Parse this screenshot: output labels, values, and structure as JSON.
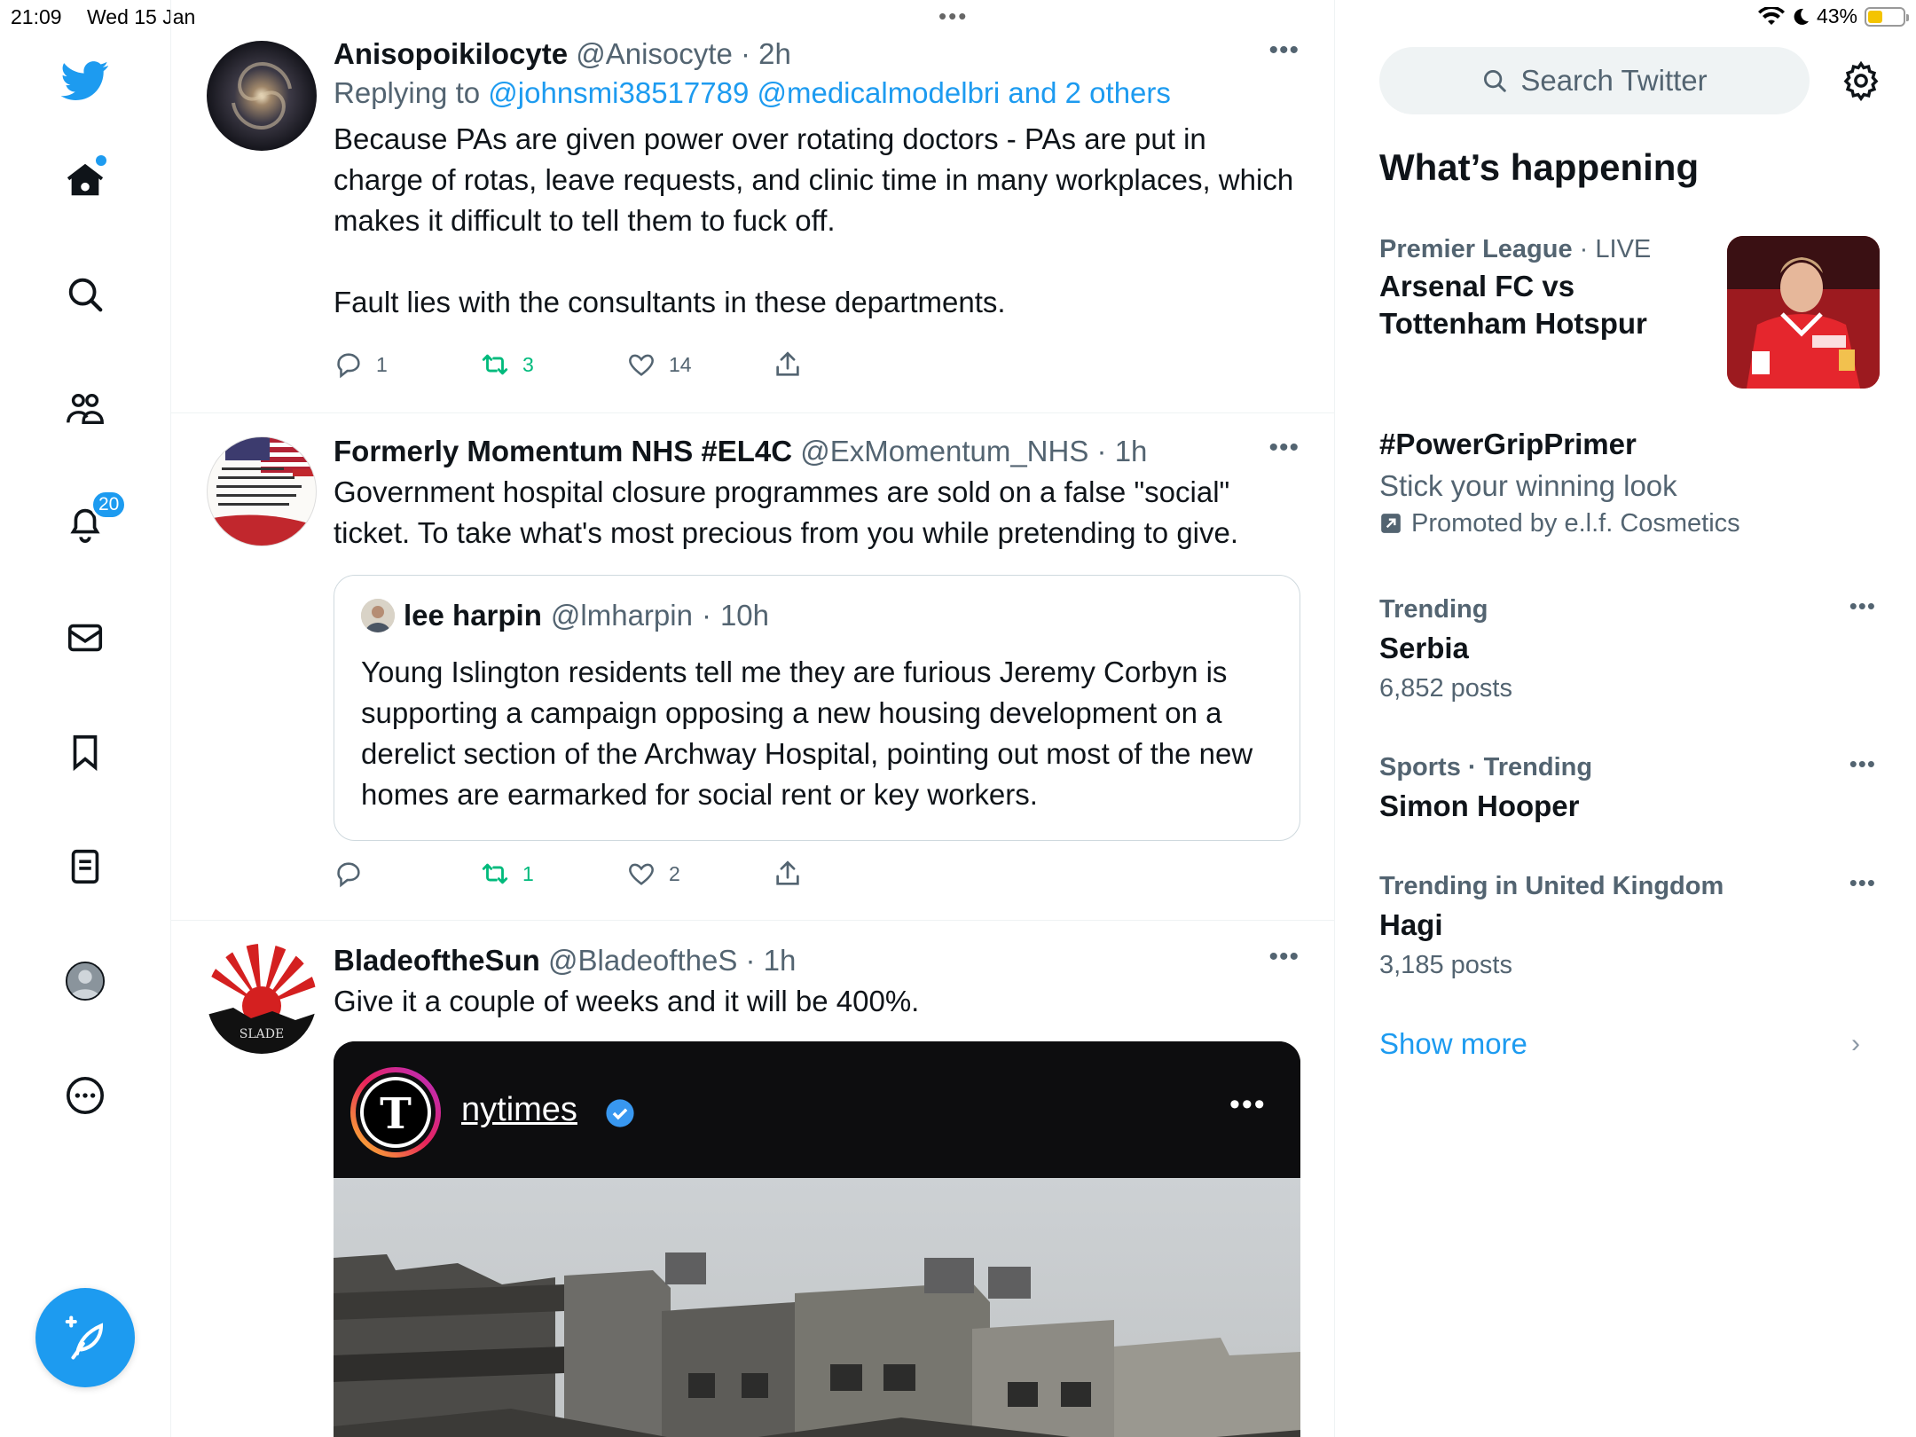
{
  "status_bar": {
    "time": "21:09",
    "date": "Wed 15 Jan",
    "battery": "43%",
    "battery_level": 0.43
  },
  "nav": {
    "notifications_count": "20",
    "icons": [
      "twitter-logo-icon",
      "home-icon",
      "search-icon",
      "communities-icon",
      "bell-icon",
      "mail-icon",
      "bookmark-icon",
      "lists-icon",
      "profile-icon",
      "more-icon"
    ]
  },
  "tweets": [
    {
      "name": "Anisopoikilocyte",
      "handle": "@Anisocyte",
      "time": "2h",
      "replying_prefix": "Replying to",
      "replying_links": "@johnsmi38517789 @medicalmodelbri and 2 others",
      "text": "Because PAs are given power over rotating doctors - PAs are put in charge of rotas, leave requests, and clinic time in many workplaces, which makes it difficult to tell them to fuck off.\n\nFault lies with the consultants in these departments.",
      "replies": "1",
      "retweets": "3",
      "likes": "14"
    },
    {
      "name": "Formerly Momentum NHS #EL4C",
      "handle": "@ExMomentum_NHS",
      "time": "1h",
      "text": "Government hospital closure programmes are sold on a false \"social\" ticket. To take what's most precious from you while pretending to give.",
      "quote": {
        "name": "lee harpin",
        "handle": "@lmharpin",
        "time": "10h",
        "text": "Young Islington residents tell me they are furious Jeremy Corbyn is supporting a campaign opposing a new housing development on a derelict section of the Archway Hospital, pointing out most of the new homes are earmarked for social rent or key workers."
      },
      "replies": "",
      "retweets": "1",
      "likes": "2"
    },
    {
      "name": "BladeoftheSun",
      "handle": "@BladeoftheS",
      "time": "1h",
      "text": "Give it a couple of weeks and it will be 400%.",
      "media_account": "nytimes"
    }
  ],
  "sidebar": {
    "search_placeholder": "Search Twitter",
    "title": "What’s happening",
    "trends": [
      {
        "category": "Premier League",
        "category_suffix": "LIVE",
        "name": "Arsenal FC vs Tottenham Hotspur"
      },
      {
        "name": "#PowerGripPrimer",
        "subtitle": "Stick your winning look",
        "promoted": "Promoted by e.l.f. Cosmetics"
      },
      {
        "category": "Trending",
        "name": "Serbia",
        "count": "6,852 posts"
      },
      {
        "category": "Sports · Trending",
        "name": "Simon Hooper"
      },
      {
        "category": "Trending in United Kingdom",
        "name": "Hagi",
        "count": "3,185 posts"
      }
    ],
    "show_more": "Show more"
  },
  "colors": {
    "accent": "#1d9bf0",
    "retweet": "#00ba7c",
    "secondary_text": "#536471"
  }
}
